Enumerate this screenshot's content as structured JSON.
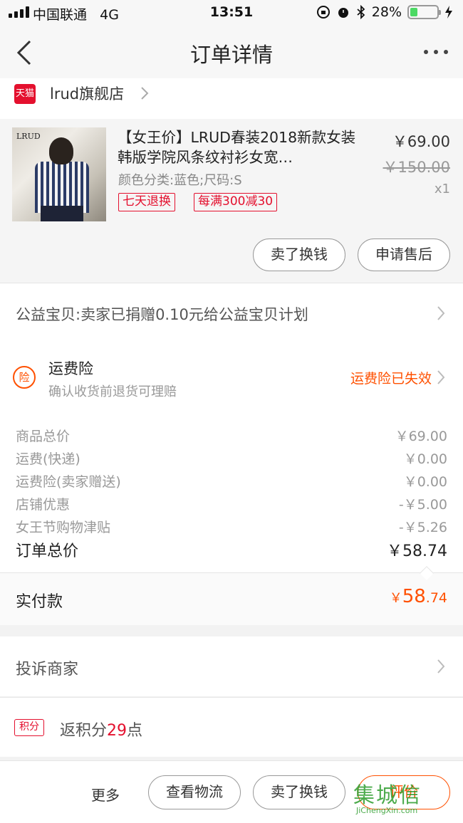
{
  "status_bar": {
    "carrier": "中国联通",
    "network": "4G",
    "time": "13:51",
    "battery": "28%",
    "battery_level": 0.28,
    "battery_color": "#4cd964"
  },
  "nav": {
    "title": "订单详情",
    "back_icon": "chevron-left-icon",
    "more_icon": "more-dots-icon"
  },
  "shop": {
    "badge": "天猫",
    "name": "lrud旗舰店"
  },
  "product": {
    "image_brand": "LRUD",
    "title": "【女王价】LRUD春装2018新款女装韩版学院风条纹衬衫女宽…",
    "sku": "颜色分类:蓝色;尺码:S",
    "tags": [
      "七天退换",
      "每满300减30"
    ],
    "price": "￥69.00",
    "original_price": "￥150.00",
    "quantity": "x1",
    "buttons": [
      "卖了换钱",
      "申请售后"
    ]
  },
  "charity": {
    "text": "公益宝贝:卖家已捐赠0.10元给公益宝贝计划"
  },
  "insurance": {
    "icon_text": "险",
    "title": "运费险",
    "subtitle": "确认收货前退货可理赔",
    "status": "运费险已失效"
  },
  "price_rows": [
    {
      "label": "商品总价",
      "value": "￥69.00"
    },
    {
      "label": "运费(快递)",
      "value": "￥0.00"
    },
    {
      "label": "运费险(卖家赠送)",
      "value": "￥0.00"
    },
    {
      "label": "店铺优惠",
      "value": "-￥5.00"
    },
    {
      "label": "女王节购物津贴",
      "value": "-￥5.26"
    }
  ],
  "order_total": {
    "label": "订单总价",
    "value": "￥58.74"
  },
  "paid": {
    "label": "实付款",
    "currency": "￥",
    "integer": "58",
    "decimal": ".74"
  },
  "complaint": {
    "text": "投诉商家"
  },
  "points": {
    "icon_text": "积分",
    "prefix": "返积分",
    "value": "29",
    "suffix": "点"
  },
  "bottom_bar": {
    "more": "更多",
    "buttons": [
      "查看物流",
      "卖了换钱",
      "评价"
    ]
  },
  "watermark": {
    "logo": "集城信",
    "url": "JiChengXin.com"
  },
  "colors": {
    "accent_orange": "#ff5000",
    "tmall_red": "#e4102e"
  }
}
